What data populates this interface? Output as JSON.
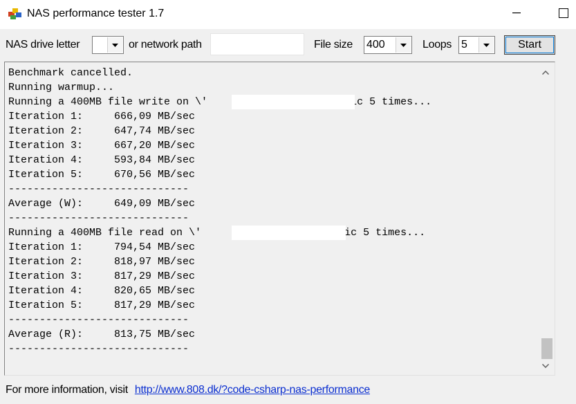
{
  "window": {
    "title": "NAS performance tester 1.7",
    "minimize_glyph": "—",
    "maximize_glyph": "☐"
  },
  "toolbar": {
    "drive_label": "NAS drive letter",
    "drive_value": "",
    "network_label": "or network path",
    "network_value": "",
    "filesize_label": "File size",
    "filesize_value": "400",
    "loops_label": "Loops",
    "loops_value": "5",
    "start_label": "Start"
  },
  "output": {
    "lines": [
      "Benchmark cancelled.",
      "Running warmup...",
      "Running a 400MB file write on \\'                  \\Public 5 times...",
      "Iteration 1:     666,09 MB/sec",
      "Iteration 2:     647,74 MB/sec",
      "Iteration 3:     667,20 MB/sec",
      "Iteration 4:     593,84 MB/sec",
      "Iteration 5:     670,56 MB/sec",
      "-----------------------------",
      "Average (W):     649,09 MB/sec",
      "-----------------------------",
      "Running a 400MB file read on \\'                  \\Public 5 times...",
      "Iteration 1:     794,54 MB/sec",
      "Iteration 2:     818,97 MB/sec",
      "Iteration 3:     817,29 MB/sec",
      "Iteration 4:     820,65 MB/sec",
      "Iteration 5:     817,29 MB/sec",
      "-----------------------------",
      "Average (R):     813,75 MB/sec",
      "-----------------------------"
    ],
    "scroll_up_glyph": "⌃",
    "scroll_down_glyph": "⌄"
  },
  "footer": {
    "text": "For more information, visit",
    "link": "http://www.808.dk/?code-csharp-nas-performance"
  },
  "colors": {
    "link": "#0b2fd0",
    "focus": "#0078d7",
    "background": "#f0f0f0"
  }
}
